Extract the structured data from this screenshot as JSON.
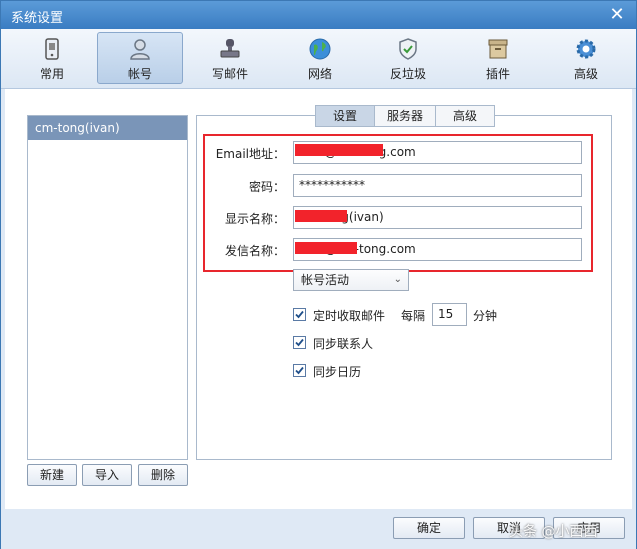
{
  "window": {
    "title": "系统设置"
  },
  "toolbar": {
    "items": [
      {
        "label": "常用",
        "icon": "device-icon"
      },
      {
        "label": "帐号",
        "icon": "user-icon",
        "active": true
      },
      {
        "label": "写邮件",
        "icon": "stamp-icon"
      },
      {
        "label": "网络",
        "icon": "globe-icon"
      },
      {
        "label": "反垃圾",
        "icon": "shield-icon"
      },
      {
        "label": "插件",
        "icon": "box-icon"
      },
      {
        "label": "高级",
        "icon": "gear-icon"
      }
    ]
  },
  "accounts": {
    "items": [
      "cm-tong(ivan)"
    ],
    "buttons": {
      "new": "新建",
      "import": "导入",
      "delete": "删除"
    }
  },
  "tabs": [
    {
      "label": "设置",
      "active": true
    },
    {
      "label": "服务器"
    },
    {
      "label": "高级"
    }
  ],
  "form": {
    "email": {
      "label": "Email地址：",
      "value": "ivan@cm-tong.com"
    },
    "password": {
      "label": "密码：",
      "value": "***********"
    },
    "display_name": {
      "label": "显示名称：",
      "value": "cm-tong(ivan)"
    },
    "sender_name": {
      "label": "发信名称：",
      "value": "ivan@cm-tong.com"
    },
    "account_status": "帐号活动",
    "auto_receive": {
      "label": "定时收取邮件",
      "checked": true,
      "every_label": "每隔",
      "interval": "15",
      "unit": "分钟"
    },
    "sync_contacts": {
      "label": "同步联系人",
      "checked": true
    },
    "sync_calendar": {
      "label": "同步日历",
      "checked": true
    }
  },
  "footer": {
    "ok": "确定",
    "cancel": "取消",
    "apply": "应用"
  },
  "watermark": "头条 @小西西",
  "colors": {
    "highlight_border": "#e8262d",
    "redaction": "#f2232b",
    "selected_account": "#7a95b8"
  }
}
